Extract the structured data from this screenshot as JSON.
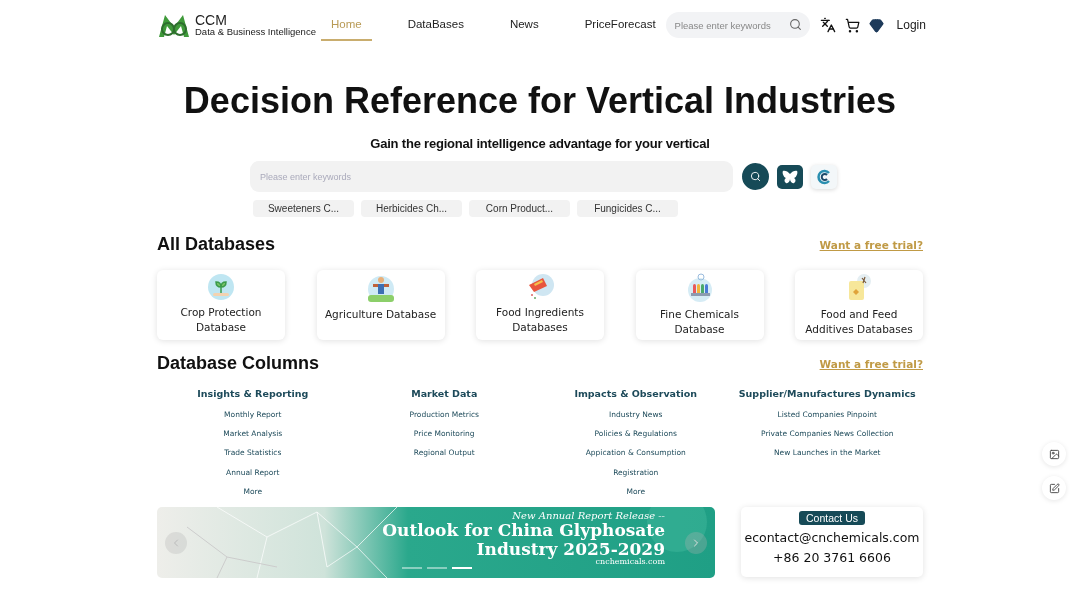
{
  "header": {
    "logo_mark": "CCM",
    "logo_tagline": "Data & Business Intelligence",
    "nav": [
      {
        "label": "Home",
        "selected": true
      },
      {
        "label": "DataBases",
        "selected": false
      },
      {
        "label": "News",
        "selected": false
      },
      {
        "label": "PriceForecast",
        "selected": false
      }
    ],
    "search": {
      "placeholder": "Please enter keywords"
    },
    "login": "Login"
  },
  "hero": {
    "title": "Decision Reference for Vertical Industries",
    "subtitle": "Gain the regional intelligence advantage for your vertical",
    "search": {
      "placeholder": "Please enter keywords"
    },
    "chips": [
      "Sweeteners C...",
      "Herbicides Ch...",
      "Corn Product...",
      "Fungicides C..."
    ]
  },
  "databases": {
    "title": "All Databases",
    "trial_link": "Want a free trial?",
    "cards": [
      "Crop Protection Database",
      "Agriculture Database",
      "Food Ingredients Databases",
      "Fine Chemicals Database",
      "Food and Feed Additives Databases"
    ]
  },
  "columns": {
    "title": "Database Columns",
    "trial_link": "Want a free trial?",
    "groups": [
      {
        "heading": "Insights & Reporting",
        "links": [
          "Monthly Report",
          "Market Analysis",
          "Trade Statistics",
          "Annual Report",
          "More"
        ]
      },
      {
        "heading": "Market Data",
        "links": [
          "Production Metrics",
          "Price Monitoring",
          "Regional Output"
        ]
      },
      {
        "heading": "Impacts & Observation",
        "links": [
          "Industry News",
          "Policies & Regulations",
          "Appication & Consumption",
          "Registration",
          "More"
        ]
      },
      {
        "heading": "Supplier/Manufactures Dynamics",
        "links": [
          "Listed Companies Pinpoint",
          "Private Companies News Collection",
          "New Launches in the Market"
        ]
      }
    ]
  },
  "banner": {
    "kicker": "New Annual Report Release --",
    "headline": "Outlook for China Glyphosate",
    "headline_2": "Industry 2025-2029",
    "site": "cnchemicals.com",
    "slides": [
      {
        "selected": false
      },
      {
        "selected": false
      },
      {
        "selected": true
      }
    ]
  },
  "contact": {
    "button": "Contact Us",
    "email": "econtact@cnchemicals.com",
    "phone": "+86 20 3761 6606"
  }
}
